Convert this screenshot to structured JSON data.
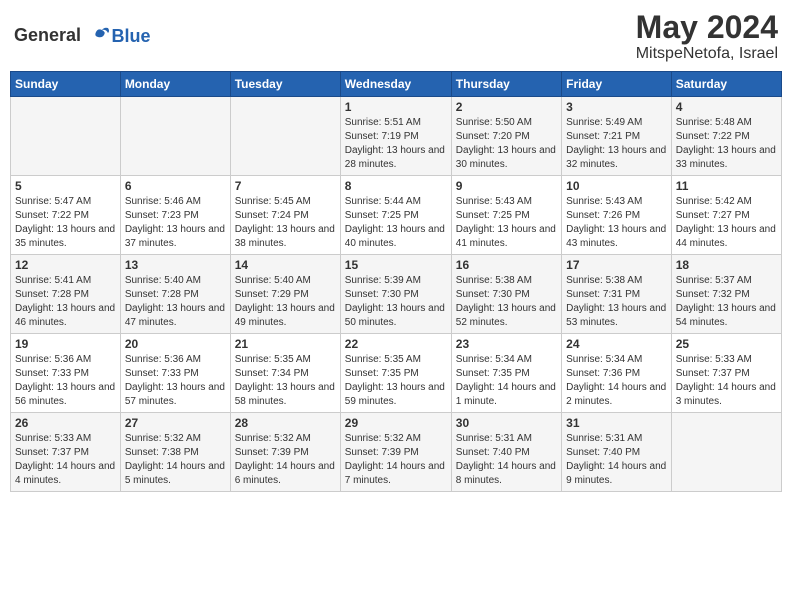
{
  "header": {
    "logo_general": "General",
    "logo_blue": "Blue",
    "month_year": "May 2024",
    "location": "MitspeNetofa, Israel"
  },
  "days_of_week": [
    "Sunday",
    "Monday",
    "Tuesday",
    "Wednesday",
    "Thursday",
    "Friday",
    "Saturday"
  ],
  "weeks": [
    [
      {
        "day": "",
        "info": ""
      },
      {
        "day": "",
        "info": ""
      },
      {
        "day": "",
        "info": ""
      },
      {
        "day": "1",
        "info": "Sunrise: 5:51 AM\nSunset: 7:19 PM\nDaylight: 13 hours\nand 28 minutes."
      },
      {
        "day": "2",
        "info": "Sunrise: 5:50 AM\nSunset: 7:20 PM\nDaylight: 13 hours\nand 30 minutes."
      },
      {
        "day": "3",
        "info": "Sunrise: 5:49 AM\nSunset: 7:21 PM\nDaylight: 13 hours\nand 32 minutes."
      },
      {
        "day": "4",
        "info": "Sunrise: 5:48 AM\nSunset: 7:22 PM\nDaylight: 13 hours\nand 33 minutes."
      }
    ],
    [
      {
        "day": "5",
        "info": "Sunrise: 5:47 AM\nSunset: 7:22 PM\nDaylight: 13 hours\nand 35 minutes."
      },
      {
        "day": "6",
        "info": "Sunrise: 5:46 AM\nSunset: 7:23 PM\nDaylight: 13 hours\nand 37 minutes."
      },
      {
        "day": "7",
        "info": "Sunrise: 5:45 AM\nSunset: 7:24 PM\nDaylight: 13 hours\nand 38 minutes."
      },
      {
        "day": "8",
        "info": "Sunrise: 5:44 AM\nSunset: 7:25 PM\nDaylight: 13 hours\nand 40 minutes."
      },
      {
        "day": "9",
        "info": "Sunrise: 5:43 AM\nSunset: 7:25 PM\nDaylight: 13 hours\nand 41 minutes."
      },
      {
        "day": "10",
        "info": "Sunrise: 5:43 AM\nSunset: 7:26 PM\nDaylight: 13 hours\nand 43 minutes."
      },
      {
        "day": "11",
        "info": "Sunrise: 5:42 AM\nSunset: 7:27 PM\nDaylight: 13 hours\nand 44 minutes."
      }
    ],
    [
      {
        "day": "12",
        "info": "Sunrise: 5:41 AM\nSunset: 7:28 PM\nDaylight: 13 hours\nand 46 minutes."
      },
      {
        "day": "13",
        "info": "Sunrise: 5:40 AM\nSunset: 7:28 PM\nDaylight: 13 hours\nand 47 minutes."
      },
      {
        "day": "14",
        "info": "Sunrise: 5:40 AM\nSunset: 7:29 PM\nDaylight: 13 hours\nand 49 minutes."
      },
      {
        "day": "15",
        "info": "Sunrise: 5:39 AM\nSunset: 7:30 PM\nDaylight: 13 hours\nand 50 minutes."
      },
      {
        "day": "16",
        "info": "Sunrise: 5:38 AM\nSunset: 7:30 PM\nDaylight: 13 hours\nand 52 minutes."
      },
      {
        "day": "17",
        "info": "Sunrise: 5:38 AM\nSunset: 7:31 PM\nDaylight: 13 hours\nand 53 minutes."
      },
      {
        "day": "18",
        "info": "Sunrise: 5:37 AM\nSunset: 7:32 PM\nDaylight: 13 hours\nand 54 minutes."
      }
    ],
    [
      {
        "day": "19",
        "info": "Sunrise: 5:36 AM\nSunset: 7:33 PM\nDaylight: 13 hours\nand 56 minutes."
      },
      {
        "day": "20",
        "info": "Sunrise: 5:36 AM\nSunset: 7:33 PM\nDaylight: 13 hours\nand 57 minutes."
      },
      {
        "day": "21",
        "info": "Sunrise: 5:35 AM\nSunset: 7:34 PM\nDaylight: 13 hours\nand 58 minutes."
      },
      {
        "day": "22",
        "info": "Sunrise: 5:35 AM\nSunset: 7:35 PM\nDaylight: 13 hours\nand 59 minutes."
      },
      {
        "day": "23",
        "info": "Sunrise: 5:34 AM\nSunset: 7:35 PM\nDaylight: 14 hours\nand 1 minute."
      },
      {
        "day": "24",
        "info": "Sunrise: 5:34 AM\nSunset: 7:36 PM\nDaylight: 14 hours\nand 2 minutes."
      },
      {
        "day": "25",
        "info": "Sunrise: 5:33 AM\nSunset: 7:37 PM\nDaylight: 14 hours\nand 3 minutes."
      }
    ],
    [
      {
        "day": "26",
        "info": "Sunrise: 5:33 AM\nSunset: 7:37 PM\nDaylight: 14 hours\nand 4 minutes."
      },
      {
        "day": "27",
        "info": "Sunrise: 5:32 AM\nSunset: 7:38 PM\nDaylight: 14 hours\nand 5 minutes."
      },
      {
        "day": "28",
        "info": "Sunrise: 5:32 AM\nSunset: 7:39 PM\nDaylight: 14 hours\nand 6 minutes."
      },
      {
        "day": "29",
        "info": "Sunrise: 5:32 AM\nSunset: 7:39 PM\nDaylight: 14 hours\nand 7 minutes."
      },
      {
        "day": "30",
        "info": "Sunrise: 5:31 AM\nSunset: 7:40 PM\nDaylight: 14 hours\nand 8 minutes."
      },
      {
        "day": "31",
        "info": "Sunrise: 5:31 AM\nSunset: 7:40 PM\nDaylight: 14 hours\nand 9 minutes."
      },
      {
        "day": "",
        "info": ""
      }
    ]
  ]
}
